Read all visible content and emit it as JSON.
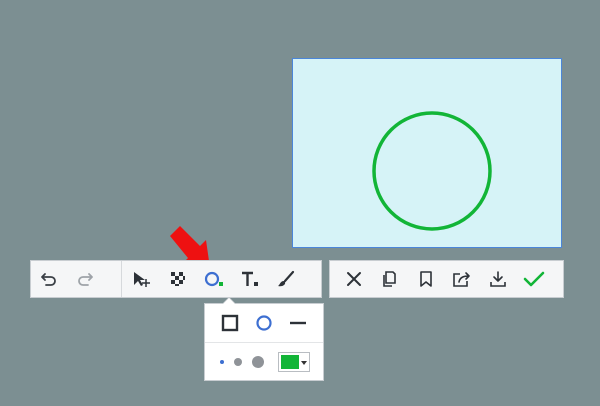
{
  "canvas": {
    "background": "#7c8f92",
    "selection_fill": "#d6f3f7",
    "selection_border": "#4b86d9",
    "shape": "circle",
    "shape_color": "#12b537"
  },
  "toolbar_left": {
    "tools": [
      {
        "icon": "undo-icon",
        "state": "enabled"
      },
      {
        "icon": "redo-icon",
        "state": "disabled"
      },
      {
        "icon": "move-pointer-icon"
      },
      {
        "icon": "mosaic-icon"
      },
      {
        "icon": "ellipse-tool-icon",
        "state": "active"
      },
      {
        "icon": "text-tool-icon"
      },
      {
        "icon": "brush-icon"
      }
    ]
  },
  "toolbar_right": {
    "actions": [
      {
        "icon": "close-icon"
      },
      {
        "icon": "copy-icon"
      },
      {
        "icon": "bookmark-icon"
      },
      {
        "icon": "share-icon"
      },
      {
        "icon": "download-icon"
      },
      {
        "icon": "confirm-check-icon"
      }
    ],
    "confirm_color": "#12b537"
  },
  "shape_popup": {
    "shapes": [
      "rectangle",
      "circle",
      "line"
    ],
    "selected_shape": "circle",
    "stroke_sizes": [
      "small",
      "medium",
      "large"
    ],
    "selected_color": "#12b537"
  },
  "pointer": {
    "icon": "red-arrow-icon",
    "color": "#ee1111"
  }
}
